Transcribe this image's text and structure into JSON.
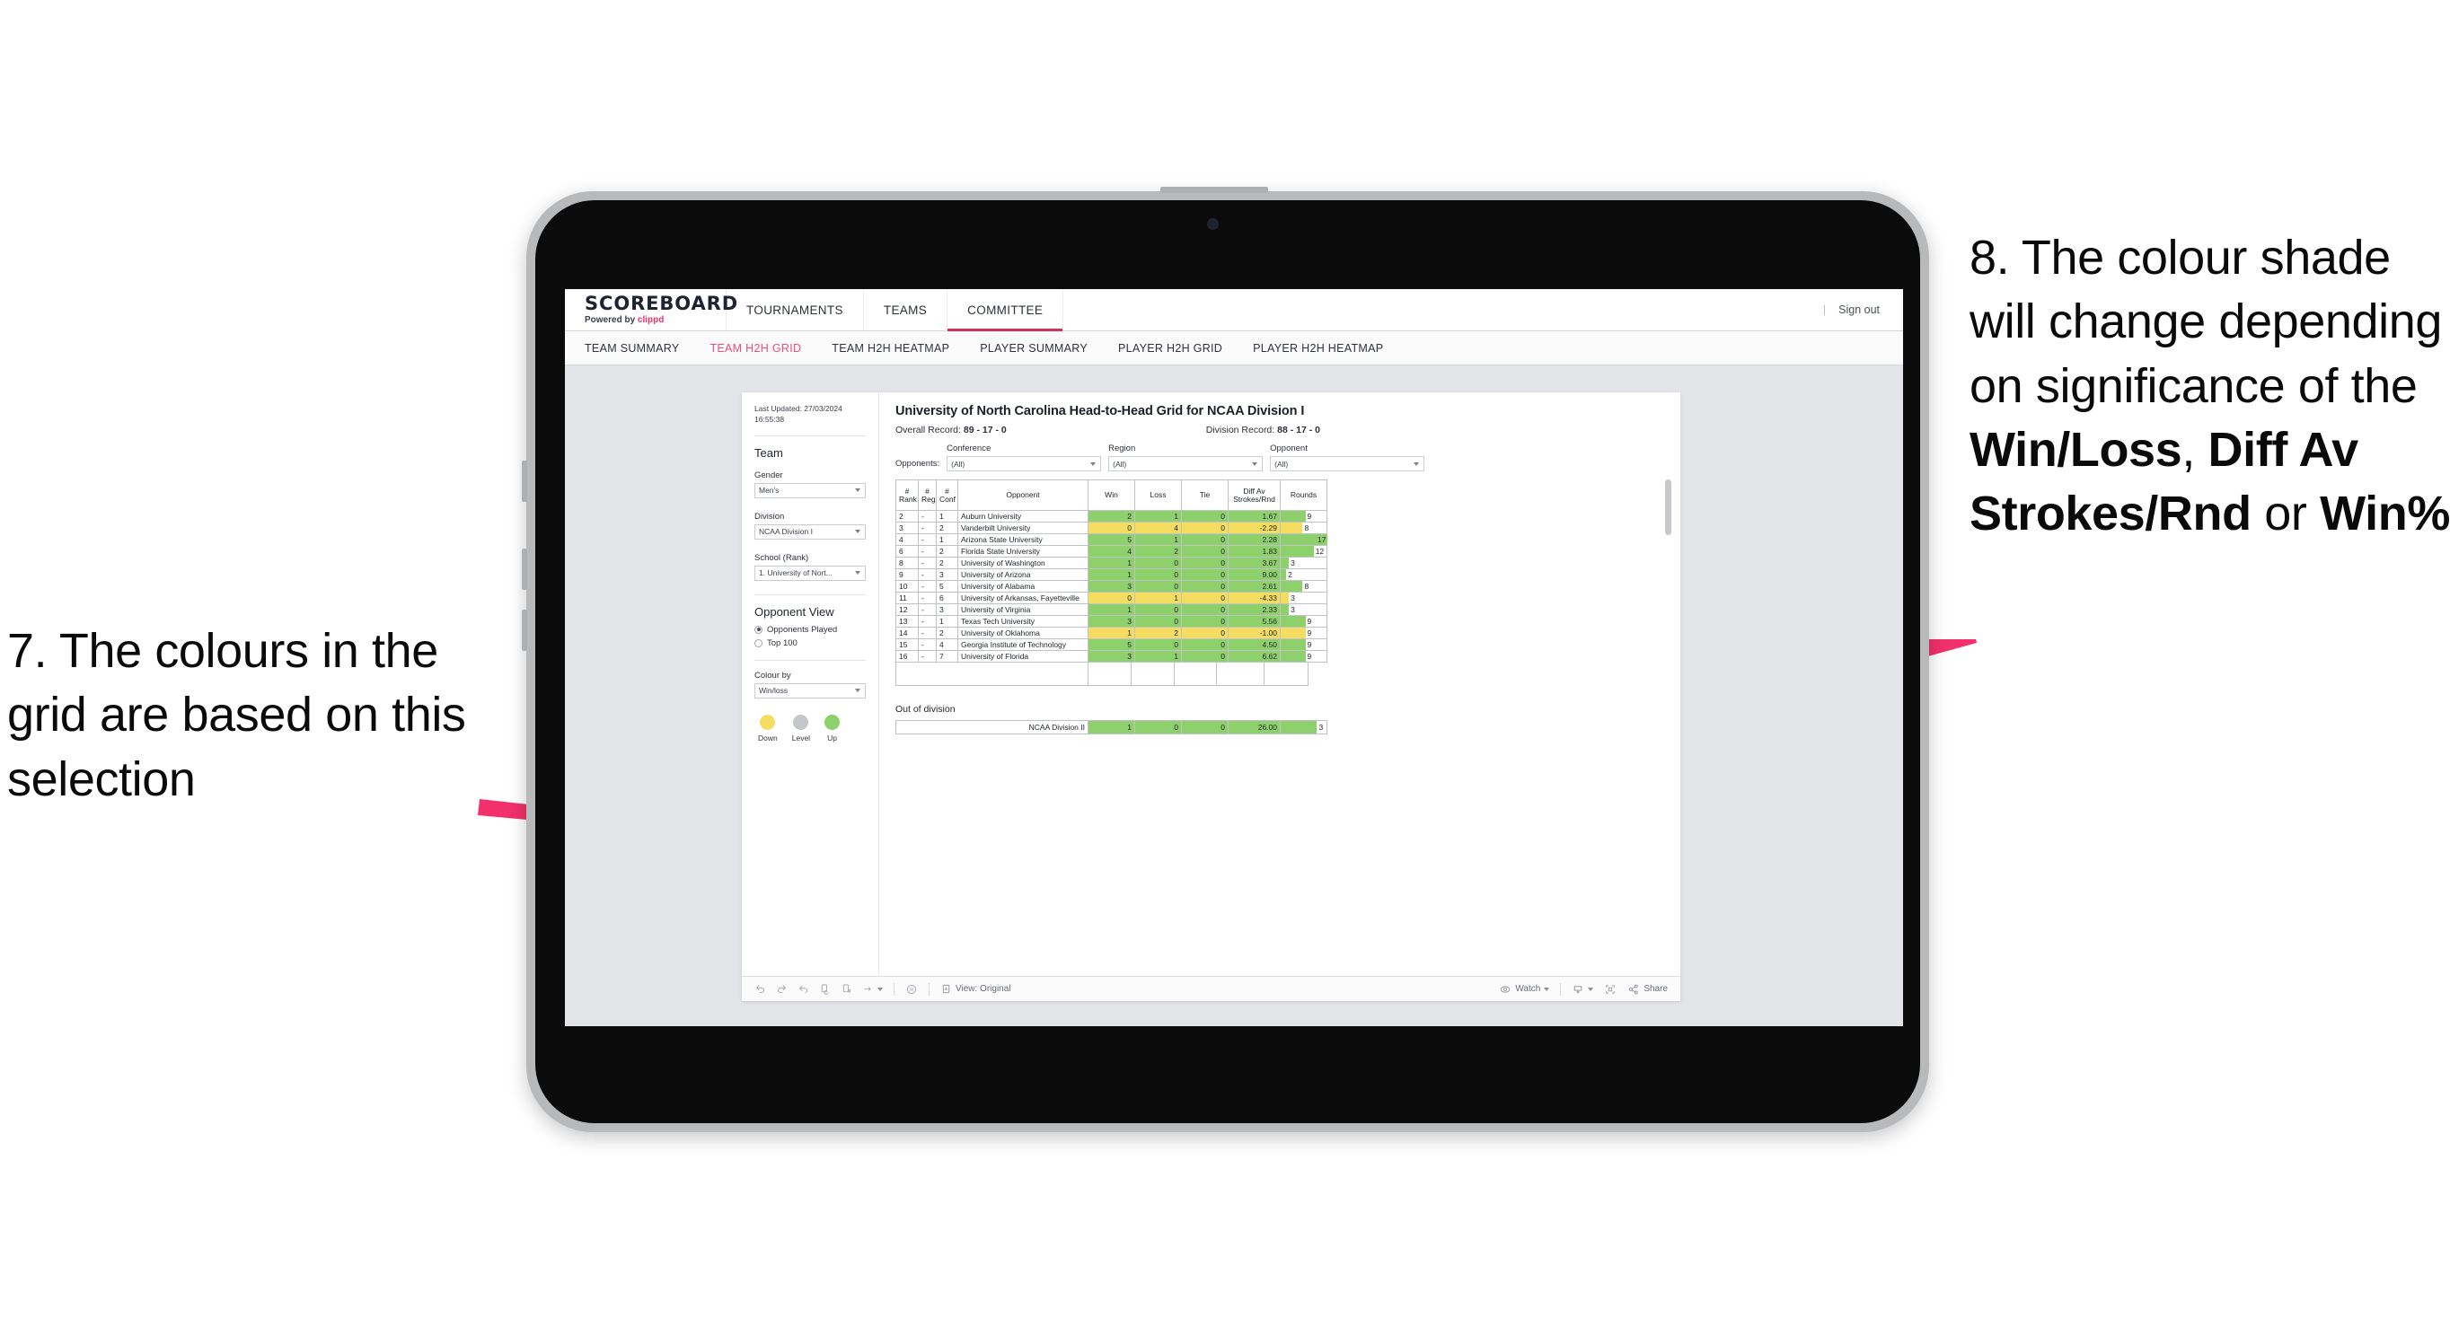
{
  "annotations": {
    "left": {
      "number": "7.",
      "text": "7. The colours in the grid are based on this selection"
    },
    "right": {
      "lead": "8. The colour shade will change depending on significance of the ",
      "bold1": "Win/Loss",
      "mid1": ", ",
      "bold2": "Diff Av Strokes/Rnd",
      "mid2": " or ",
      "bold3": "Win%"
    }
  },
  "colors": {
    "accent_pink": "#ee4d7a",
    "brand_pink": "#f0336c",
    "up_green": "#8ed06c",
    "down_yellow": "#f5dd62",
    "level_grey": "#c4c6ca",
    "workspace_bg": "#e3e4e8"
  },
  "app": {
    "brand_title": "SCOREBOARD",
    "brand_sub_prefix": "Powered by ",
    "brand_sub_name": "clippd",
    "top_nav": [
      {
        "label": "TOURNAMENTS",
        "active": false
      },
      {
        "label": "TEAMS",
        "active": false
      },
      {
        "label": "COMMITTEE",
        "active": true
      }
    ],
    "sign_out": "Sign out",
    "divider": "|",
    "sub_nav": [
      {
        "label": "TEAM SUMMARY",
        "active": false
      },
      {
        "label": "TEAM H2H GRID",
        "active": true
      },
      {
        "label": "TEAM H2H HEATMAP",
        "active": false
      },
      {
        "label": "PLAYER SUMMARY",
        "active": false
      },
      {
        "label": "PLAYER H2H GRID",
        "active": false
      },
      {
        "label": "PLAYER H2H HEATMAP",
        "active": false
      }
    ]
  },
  "left_panel": {
    "last_updated_line1": "Last Updated: 27/03/2024",
    "last_updated_line2": "16:55:38",
    "team_heading": "Team",
    "gender_label": "Gender",
    "gender_value": "Men's",
    "division_label": "Division",
    "division_value": "NCAA Division I",
    "school_label": "School (Rank)",
    "school_value": "1. University of Nort...",
    "opponent_view_heading": "Opponent View",
    "opponent_view_options": [
      {
        "label": "Opponents Played",
        "selected": true
      },
      {
        "label": "Top 100",
        "selected": false
      }
    ],
    "colour_by_label": "Colour by",
    "colour_by_value": "Win/loss",
    "legend": [
      {
        "name": "Down",
        "color": "#f5dd62"
      },
      {
        "name": "Level",
        "color": "#c4c6ca"
      },
      {
        "name": "Up",
        "color": "#8ed06c"
      }
    ]
  },
  "viz": {
    "title": "University of North Carolina Head-to-Head Grid for NCAA Division I",
    "overall_record_label": "Overall Record:",
    "overall_record_value": "89 - 17 - 0",
    "division_record_label": "Division Record:",
    "division_record_value": "88 - 17 - 0",
    "opponents_label": "Opponents:",
    "filters": [
      {
        "caption": "Conference",
        "value": "(All)"
      },
      {
        "caption": "Region",
        "value": "(All)"
      },
      {
        "caption": "Opponent",
        "value": "(All)"
      }
    ]
  },
  "chart_data": {
    "type": "table",
    "title": "University of North Carolina Head-to-Head Grid for NCAA Division I",
    "columns": [
      "# Rank",
      "# Reg",
      "# Conf",
      "Opponent",
      "Win",
      "Loss",
      "Tie",
      "Diff Av Strokes/Rnd",
      "Rounds"
    ],
    "rounds_axis_max": 17,
    "rows": [
      {
        "rank": "2",
        "reg": "-",
        "conf": "1",
        "opponent": "Auburn University",
        "win": "2",
        "loss": "1",
        "tie": "0",
        "diff": "1.67",
        "rounds": "9",
        "state": "up"
      },
      {
        "rank": "3",
        "reg": "-",
        "conf": "2",
        "opponent": "Vanderbilt University",
        "win": "0",
        "loss": "4",
        "tie": "0",
        "diff": "-2.29",
        "rounds": "8",
        "state": "down"
      },
      {
        "rank": "4",
        "reg": "-",
        "conf": "1",
        "opponent": "Arizona State University",
        "win": "5",
        "loss": "1",
        "tie": "0",
        "diff": "2.28",
        "rounds": "17",
        "state": "up"
      },
      {
        "rank": "6",
        "reg": "-",
        "conf": "2",
        "opponent": "Florida State University",
        "win": "4",
        "loss": "2",
        "tie": "0",
        "diff": "1.83",
        "rounds": "12",
        "state": "up"
      },
      {
        "rank": "8",
        "reg": "-",
        "conf": "2",
        "opponent": "University of Washington",
        "win": "1",
        "loss": "0",
        "tie": "0",
        "diff": "3.67",
        "rounds": "3",
        "state": "up"
      },
      {
        "rank": "9",
        "reg": "-",
        "conf": "3",
        "opponent": "University of Arizona",
        "win": "1",
        "loss": "0",
        "tie": "0",
        "diff": "9.00",
        "rounds": "2",
        "state": "up"
      },
      {
        "rank": "10",
        "reg": "-",
        "conf": "5",
        "opponent": "University of Alabama",
        "win": "3",
        "loss": "0",
        "tie": "0",
        "diff": "2.61",
        "rounds": "8",
        "state": "up"
      },
      {
        "rank": "11",
        "reg": "-",
        "conf": "6",
        "opponent": "University of Arkansas, Fayetteville",
        "win": "0",
        "loss": "1",
        "tie": "0",
        "diff": "-4.33",
        "rounds": "3",
        "state": "down"
      },
      {
        "rank": "12",
        "reg": "-",
        "conf": "3",
        "opponent": "University of Virginia",
        "win": "1",
        "loss": "0",
        "tie": "0",
        "diff": "2.33",
        "rounds": "3",
        "state": "up"
      },
      {
        "rank": "13",
        "reg": "-",
        "conf": "1",
        "opponent": "Texas Tech University",
        "win": "3",
        "loss": "0",
        "tie": "0",
        "diff": "5.56",
        "rounds": "9",
        "state": "up"
      },
      {
        "rank": "14",
        "reg": "-",
        "conf": "2",
        "opponent": "University of Oklahoma",
        "win": "1",
        "loss": "2",
        "tie": "0",
        "diff": "-1.00",
        "rounds": "9",
        "state": "down"
      },
      {
        "rank": "15",
        "reg": "-",
        "conf": "4",
        "opponent": "Georgia Institute of Technology",
        "win": "5",
        "loss": "0",
        "tie": "0",
        "diff": "4.50",
        "rounds": "9",
        "state": "up"
      },
      {
        "rank": "16",
        "reg": "-",
        "conf": "7",
        "opponent": "University of Florida",
        "win": "3",
        "loss": "1",
        "tie": "0",
        "diff": "6.62",
        "rounds": "9",
        "state": "up"
      }
    ],
    "out_of_division": {
      "title": "Out of division",
      "rows": [
        {
          "label": "NCAA Division II",
          "win": "1",
          "loss": "0",
          "tie": "0",
          "diff": "26.00",
          "rounds": "3",
          "state": "up"
        }
      ]
    }
  },
  "toolbar": {
    "view_label": "View: Original",
    "watch_label": "Watch",
    "share_label": "Share",
    "icons": [
      "undo-icon",
      "redo-icon",
      "revert-icon",
      "refresh-data-icon",
      "pause-icon",
      "subscribe-icon",
      "device-layout-icon"
    ]
  }
}
